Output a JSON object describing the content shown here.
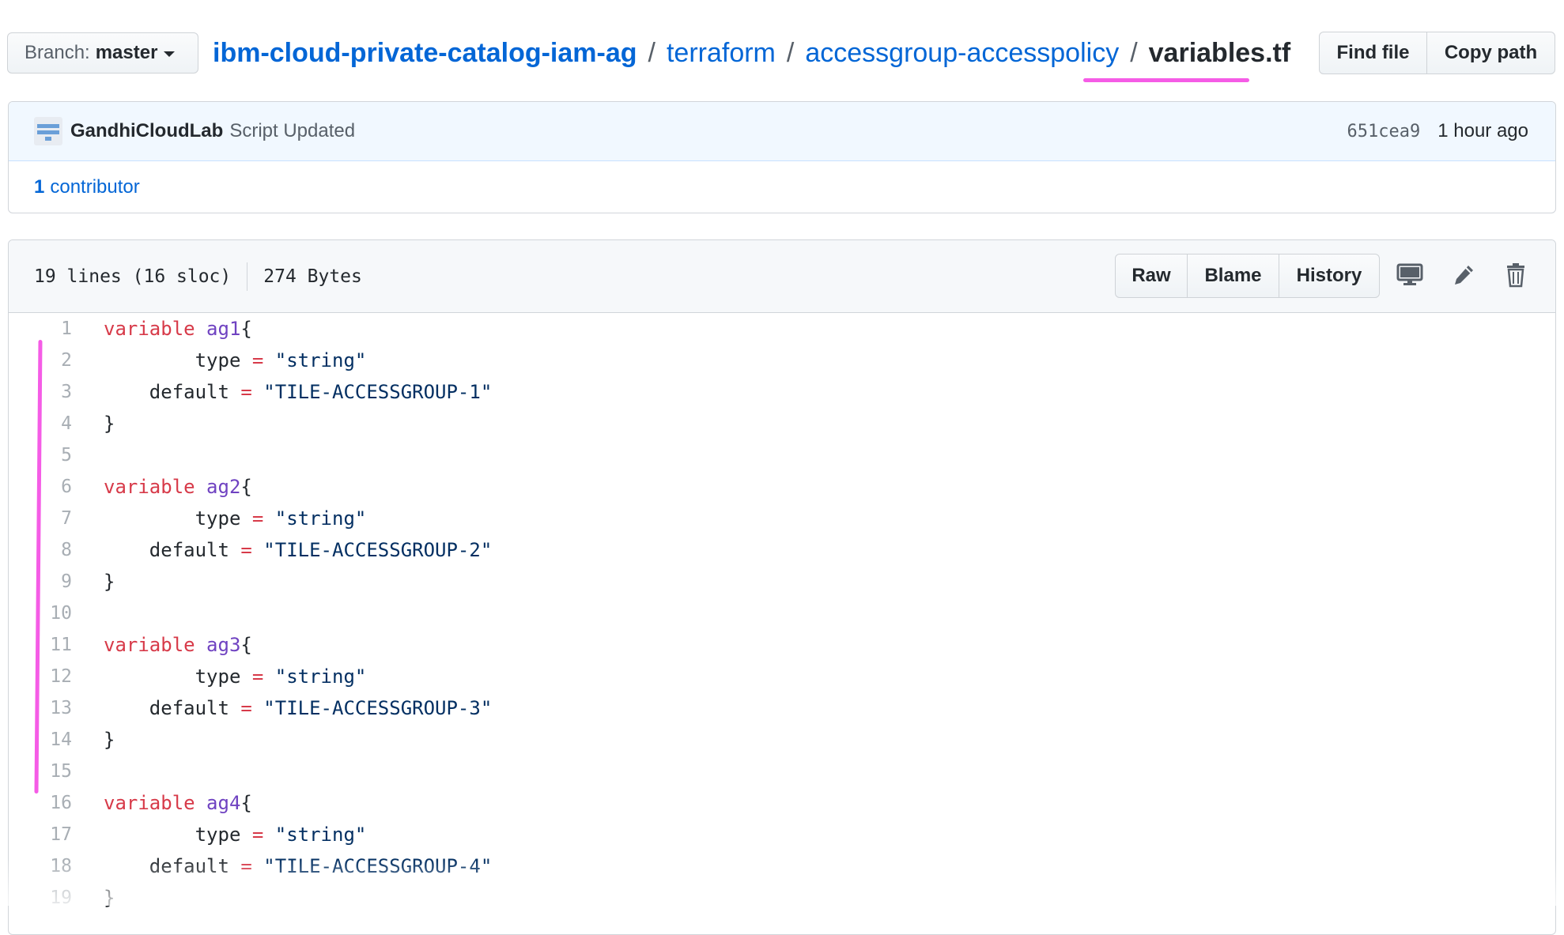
{
  "branch": {
    "prefix": "Branch:",
    "name": "master"
  },
  "breadcrumb": {
    "repo": "ibm-cloud-private-catalog-iam-ag",
    "sep": "/",
    "dirs": [
      "terraform",
      "accessgroup-accesspolicy"
    ],
    "file": "variables.tf"
  },
  "actions": {
    "find_file": "Find file",
    "copy_path": "Copy path"
  },
  "commit": {
    "author": "GandhiCloudLab",
    "message": "Script Updated",
    "sha": "651cea9",
    "age": "1 hour ago",
    "contributors_count": "1",
    "contributors_label": "contributor"
  },
  "file": {
    "lines_info": "19 lines (16 sloc)",
    "size": "274 Bytes",
    "buttons": {
      "raw": "Raw",
      "blame": "Blame",
      "history": "History"
    },
    "icons": [
      "desktop-icon",
      "pencil-icon",
      "trash-icon"
    ]
  },
  "code_lines": [
    {
      "n": "1",
      "tokens": [
        [
          "kw",
          "variable"
        ],
        [
          "t",
          " "
        ],
        [
          "id",
          "ag1"
        ],
        [
          "t",
          "{"
        ]
      ]
    },
    {
      "n": "2",
      "tokens": [
        [
          "t",
          "        type "
        ],
        [
          "op",
          "="
        ],
        [
          "t",
          " "
        ],
        [
          "str",
          "\"string\""
        ]
      ]
    },
    {
      "n": "3",
      "tokens": [
        [
          "t",
          "    default "
        ],
        [
          "op",
          "="
        ],
        [
          "t",
          " "
        ],
        [
          "str",
          "\"TILE-ACCESSGROUP-1\""
        ]
      ]
    },
    {
      "n": "4",
      "tokens": [
        [
          "t",
          "}"
        ]
      ]
    },
    {
      "n": "5",
      "tokens": []
    },
    {
      "n": "6",
      "tokens": [
        [
          "kw",
          "variable"
        ],
        [
          "t",
          " "
        ],
        [
          "id",
          "ag2"
        ],
        [
          "t",
          "{"
        ]
      ]
    },
    {
      "n": "7",
      "tokens": [
        [
          "t",
          "        type "
        ],
        [
          "op",
          "="
        ],
        [
          "t",
          " "
        ],
        [
          "str",
          "\"string\""
        ]
      ]
    },
    {
      "n": "8",
      "tokens": [
        [
          "t",
          "    default "
        ],
        [
          "op",
          "="
        ],
        [
          "t",
          " "
        ],
        [
          "str",
          "\"TILE-ACCESSGROUP-2\""
        ]
      ]
    },
    {
      "n": "9",
      "tokens": [
        [
          "t",
          "}"
        ]
      ]
    },
    {
      "n": "10",
      "tokens": []
    },
    {
      "n": "11",
      "tokens": [
        [
          "kw",
          "variable"
        ],
        [
          "t",
          " "
        ],
        [
          "id",
          "ag3"
        ],
        [
          "t",
          "{"
        ]
      ]
    },
    {
      "n": "12",
      "tokens": [
        [
          "t",
          "        type "
        ],
        [
          "op",
          "="
        ],
        [
          "t",
          " "
        ],
        [
          "str",
          "\"string\""
        ]
      ]
    },
    {
      "n": "13",
      "tokens": [
        [
          "t",
          "    default "
        ],
        [
          "op",
          "="
        ],
        [
          "t",
          " "
        ],
        [
          "str",
          "\"TILE-ACCESSGROUP-3\""
        ]
      ]
    },
    {
      "n": "14",
      "tokens": [
        [
          "t",
          "}"
        ]
      ]
    },
    {
      "n": "15",
      "tokens": []
    },
    {
      "n": "16",
      "tokens": [
        [
          "kw",
          "variable"
        ],
        [
          "t",
          " "
        ],
        [
          "id",
          "ag4"
        ],
        [
          "t",
          "{"
        ]
      ]
    },
    {
      "n": "17",
      "tokens": [
        [
          "t",
          "        type "
        ],
        [
          "op",
          "="
        ],
        [
          "t",
          " "
        ],
        [
          "str",
          "\"string\""
        ]
      ]
    },
    {
      "n": "18",
      "tokens": [
        [
          "t",
          "    default "
        ],
        [
          "op",
          "="
        ],
        [
          "t",
          " "
        ],
        [
          "str",
          "\"TILE-ACCESSGROUP-4\""
        ]
      ]
    },
    {
      "n": "19",
      "tokens": [
        [
          "t",
          "}"
        ]
      ]
    }
  ],
  "colors": {
    "link": "#0366d6",
    "keyword": "#d73a49",
    "identifier": "#6f42c1",
    "string": "#032f62",
    "annotation_highlight": "#f55ce6"
  }
}
